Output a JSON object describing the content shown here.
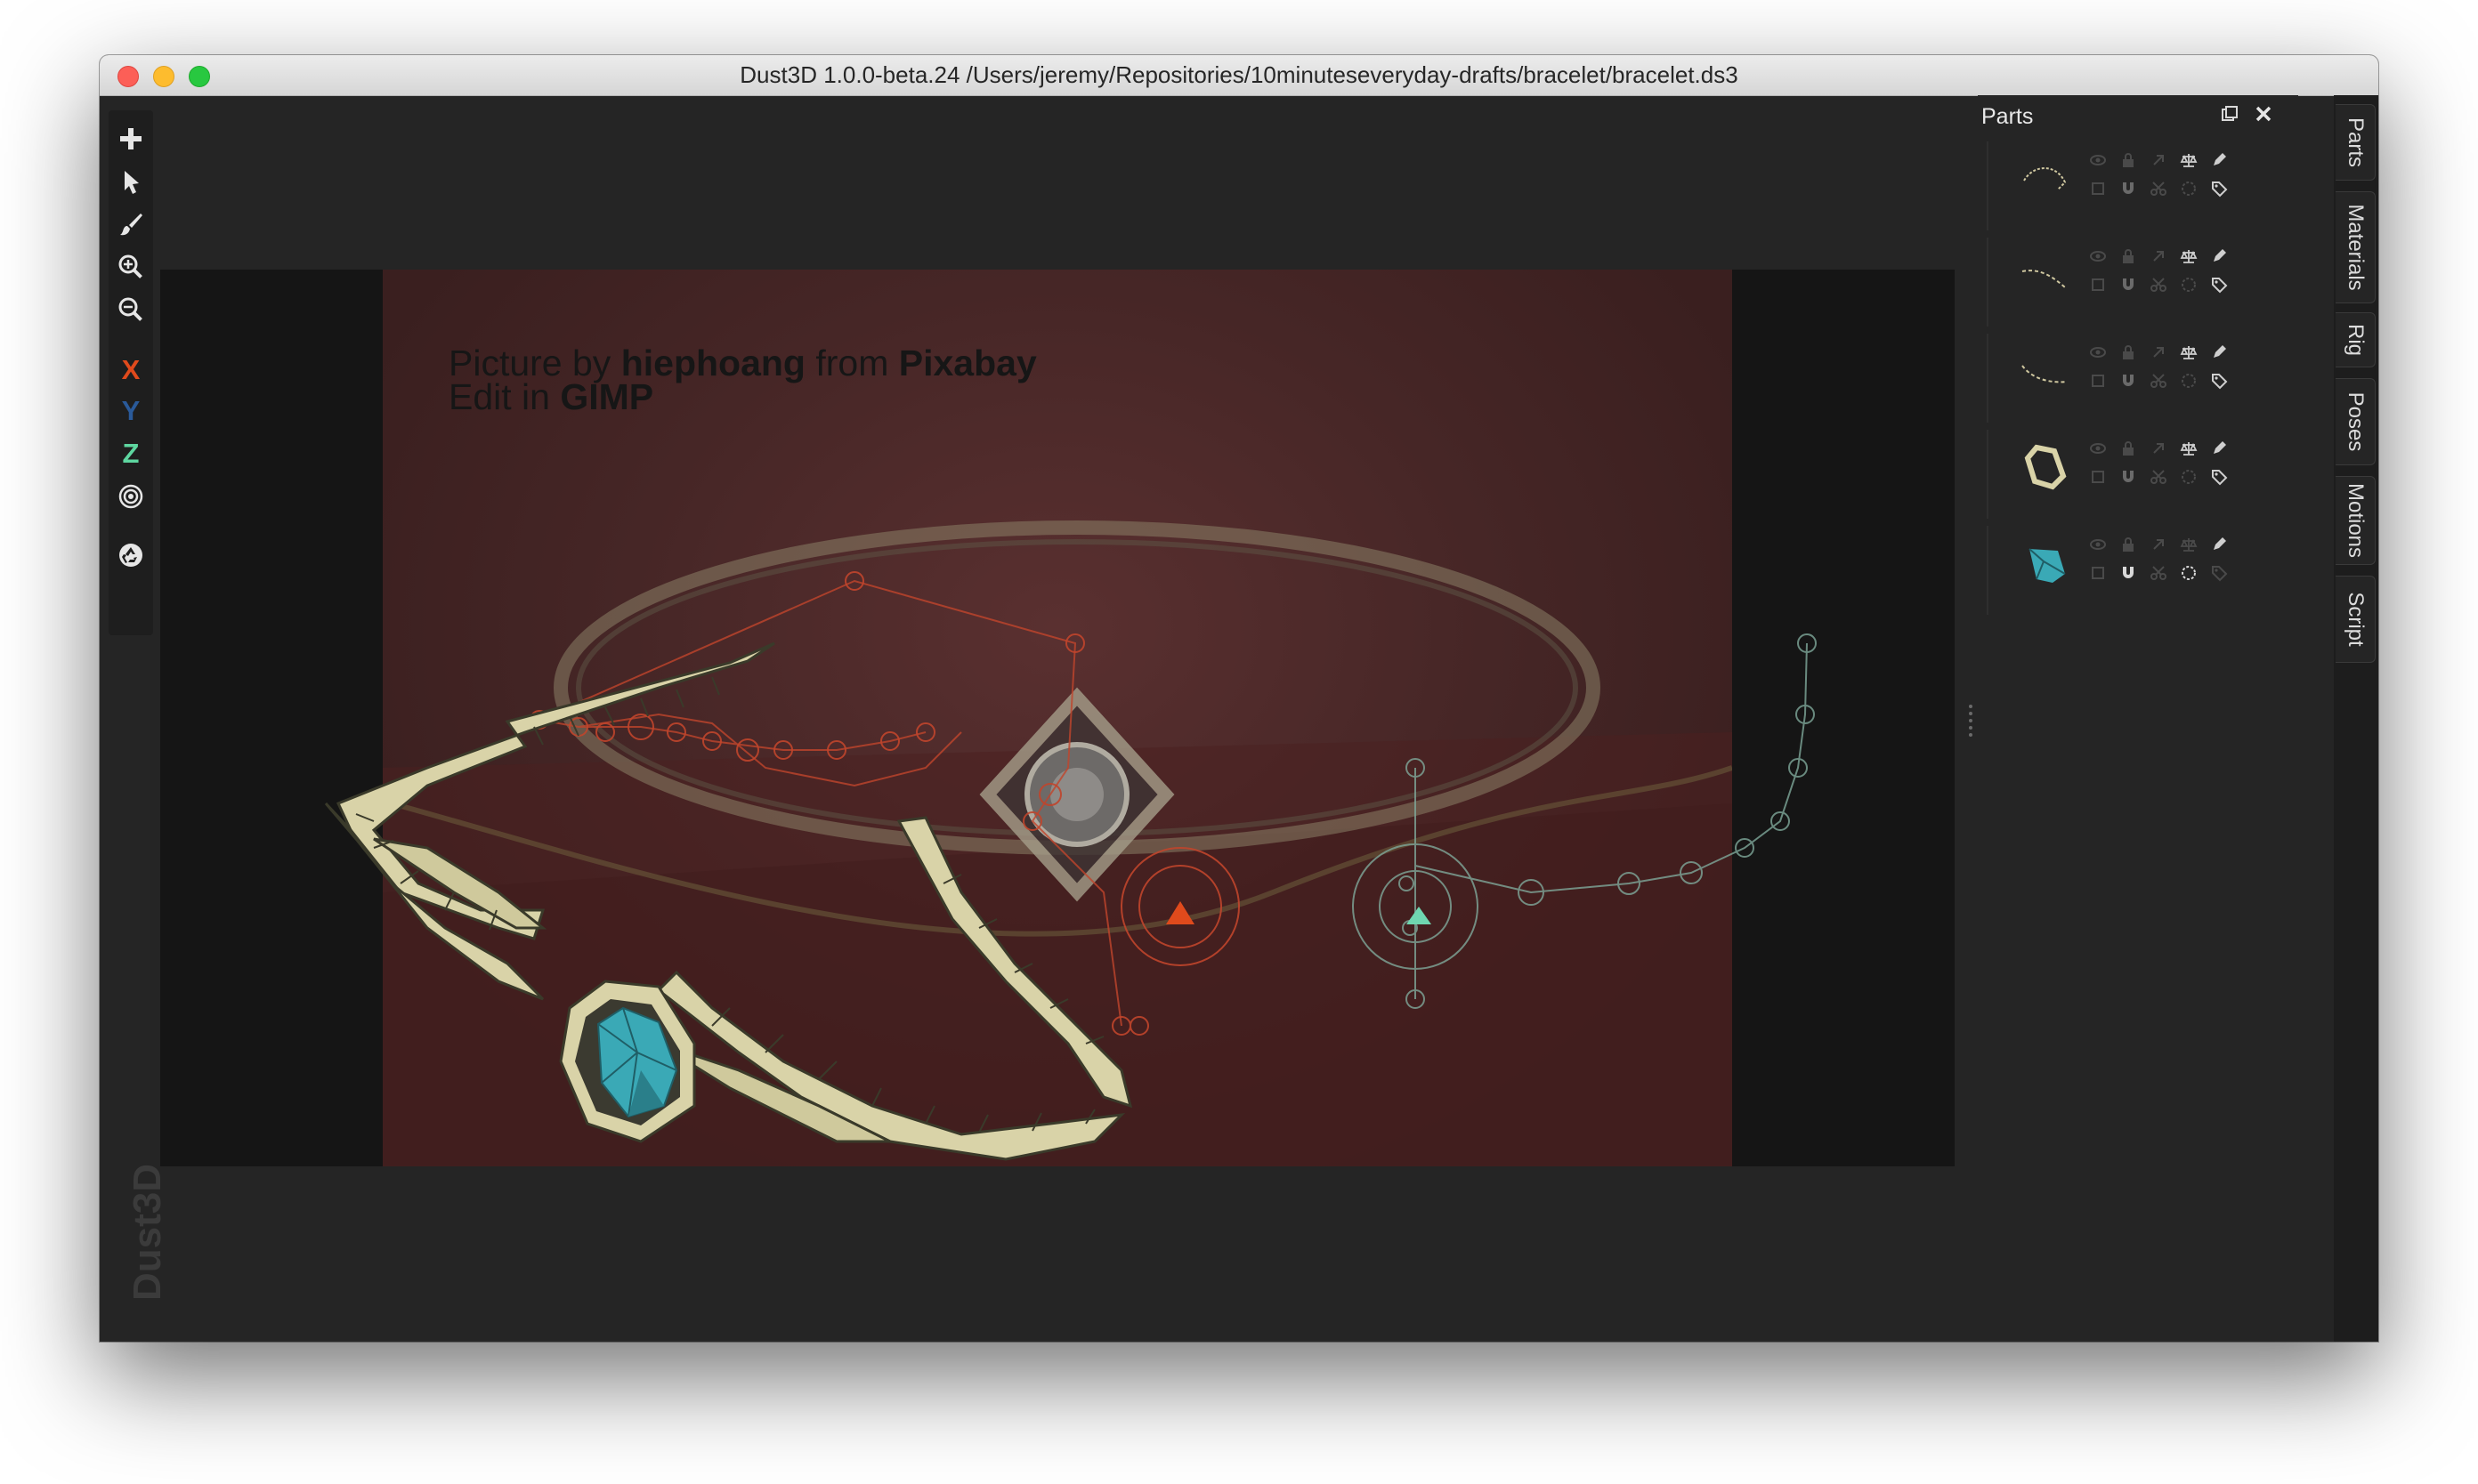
{
  "window": {
    "title": "Dust3D 1.0.0-beta.24 /Users/jeremy/Repositories/10minuteseveryday-drafts/bracelet/bracelet.ds3"
  },
  "toolbar": {
    "add_icon": "plus-icon",
    "select_icon": "arrow-pointer-icon",
    "paint_icon": "brush-icon",
    "zoom_in_icon": "zoom-in-icon",
    "zoom_out_icon": "zoom-out-icon",
    "x_label": "X",
    "y_label": "Y",
    "z_label": "Z",
    "radius_icon": "radius-target-icon",
    "regenerate_icon": "recycle-icon",
    "colors": {
      "x": "#e04a1c",
      "y": "#2a5a9a",
      "z": "#5ed6a0"
    }
  },
  "viewport": {
    "reference_caption": {
      "line1_prefix": "Picture by ",
      "line1_author": "hiephoang",
      "line1_middle": " from ",
      "line1_site": "Pixabay",
      "line2_prefix": "Edit in ",
      "line2_app": "GIMP"
    },
    "watermark": "Dust3D",
    "mesh_color": "#d9d3a8",
    "gem_color": "#3aa9b6"
  },
  "parts_panel": {
    "title": "Parts",
    "float_icon": "float-window-icon",
    "close_icon": "close-icon",
    "parts": [
      {
        "thumb": "thin-curve",
        "color": "#cfc7a0",
        "row1": [
          "eye-icon",
          "lock-icon",
          "link-icon",
          "balance-icon",
          "pencil-icon"
        ],
        "row2": [
          "checkbox-icon",
          "magnet-icon",
          "scissors-icon",
          "rotate-icon",
          "tag-icon"
        ]
      },
      {
        "thumb": "thin-curve-2",
        "color": "#cfc7a0",
        "row1": [
          "eye-icon",
          "lock-icon",
          "link-icon",
          "balance-icon",
          "pencil-icon"
        ],
        "row2": [
          "checkbox-icon",
          "magnet-icon",
          "scissors-icon",
          "rotate-icon",
          "tag-icon"
        ]
      },
      {
        "thumb": "thin-curve-3",
        "color": "#cfc7a0",
        "row1": [
          "eye-icon",
          "lock-icon",
          "link-icon",
          "balance-icon",
          "pencil-icon"
        ],
        "row2": [
          "checkbox-icon",
          "magnet-icon",
          "scissors-icon",
          "rotate-icon",
          "tag-icon"
        ]
      },
      {
        "thumb": "ring",
        "color": "#d9d3a8",
        "row1": [
          "eye-icon",
          "lock-icon",
          "link-icon",
          "balance-icon",
          "pencil-icon"
        ],
        "row2": [
          "checkbox-icon",
          "magnet-icon",
          "scissors-icon",
          "rotate-icon",
          "tag-icon"
        ]
      },
      {
        "thumb": "gem",
        "color": "#3aa9b6",
        "row1": [
          "eye-icon",
          "lock-icon",
          "link-icon",
          "balance-icon",
          "pencil-icon"
        ],
        "row2": [
          "checkbox-icon",
          "magnet-icon",
          "scissors-icon",
          "rotate-icon",
          "tag-icon"
        ]
      }
    ]
  },
  "side_tabs": [
    "Parts",
    "Materials",
    "Rig",
    "Poses",
    "Motions",
    "Script"
  ]
}
